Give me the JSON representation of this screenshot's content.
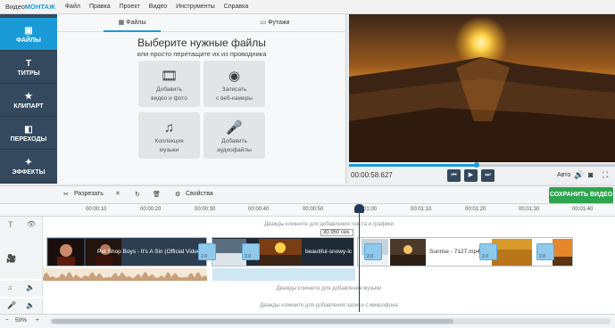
{
  "app": {
    "logo_prefix": "Видео",
    "logo_brand": "МОНТАЖ"
  },
  "menu": [
    "Файл",
    "Правка",
    "Проект",
    "Видео",
    "Инструменты",
    "Справка"
  ],
  "sidebar": [
    {
      "label": "ФАЙЛЫ",
      "icon": "folder-icon",
      "glyph": "▣",
      "active": true
    },
    {
      "label": "ТИТРЫ",
      "icon": "titles-icon",
      "glyph": "T",
      "active": false
    },
    {
      "label": "КЛИПАРТ",
      "icon": "star-icon",
      "glyph": "★",
      "active": false
    },
    {
      "label": "ПЕРЕХОДЫ",
      "icon": "transitions-icon",
      "glyph": "◧",
      "active": false
    },
    {
      "label": "ЭФФЕКТЫ",
      "icon": "magic-wand-icon",
      "glyph": "✦",
      "active": false
    }
  ],
  "panel": {
    "tabs": [
      {
        "label": "Файлы",
        "glyph": "▦"
      },
      {
        "label": "Футажи",
        "glyph": "▭"
      }
    ],
    "heading": "Выберите нужные файлы",
    "subheading": "или просто перетащите их из проводника",
    "tiles": [
      {
        "line1": "Добавить",
        "line2": "видео и фото",
        "icon": "film-camera-icon",
        "glyph": "🎞"
      },
      {
        "line1": "Записать",
        "line2": "с веб-камеры",
        "icon": "webcam-icon",
        "glyph": "◉"
      },
      {
        "line1": "Коллекция",
        "line2": "музыки",
        "icon": "music-notes-icon",
        "glyph": "♫"
      },
      {
        "line1": "Добавить",
        "line2": "аудиофайлы",
        "icon": "microphone-icon",
        "glyph": "🎤"
      }
    ]
  },
  "preview": {
    "timecode": "00:00:58.627",
    "auto_label": "Авто",
    "progress": 0.48
  },
  "toolbar": {
    "cut": "Разрезать",
    "properties": "Свойства",
    "save": "СОХРАНИТЬ ВИДЕО"
  },
  "ruler": [
    "00:00:10",
    "00:00:20",
    "00:00:30",
    "00:00:40",
    "00:00:50",
    "01:00",
    "00:01:10",
    "00:01:20",
    "00:01:30",
    "00:01:40"
  ],
  "tracks": {
    "text_hint": "Дважды кликните для добавления текста и графики",
    "music_hint": "Дважды кликните для добавления музыки",
    "mic_hint": "Дважды кликните для добавления записи с микрофона",
    "clips": [
      {
        "label": "Pet Shop Boys - It's A Sin (Official Video)"
      },
      {
        "label": "beautiful-snowy-lc"
      },
      {
        "label": "Sunrise - 7127.mp4"
      }
    ],
    "transition_value": "2.0",
    "cursor_time": "30.950 сек."
  },
  "bottom": {
    "zoom": "50%"
  },
  "colors": {
    "accent": "#1a9bd7",
    "sidebar": "#34495e",
    "save": "#2ea44f"
  }
}
